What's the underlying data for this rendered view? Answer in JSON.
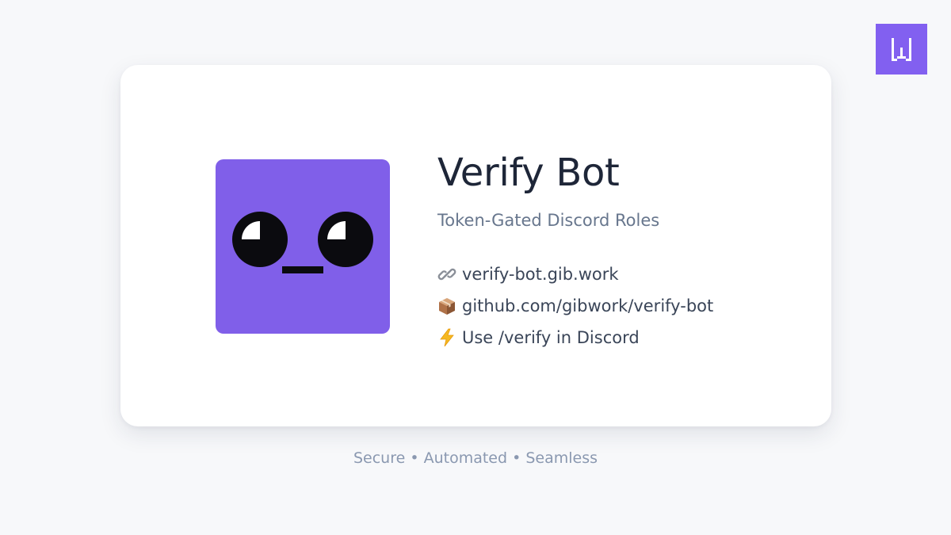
{
  "brand": {
    "icon": "w-logo-icon",
    "color": "#8260f0"
  },
  "card": {
    "avatar": {
      "icon": "bot-face-icon",
      "color": "#805fe9"
    },
    "title": "Verify Bot",
    "subtitle": "Token-Gated Discord Roles",
    "links": [
      {
        "icon": "link-icon",
        "text": "verify-bot.gib.work"
      },
      {
        "icon": "package-icon",
        "text": "github.com/gibwork/verify-bot"
      },
      {
        "icon": "lightning-icon",
        "text": "Use /verify in Discord"
      }
    ]
  },
  "tagline": "Secure • Automated • Seamless"
}
